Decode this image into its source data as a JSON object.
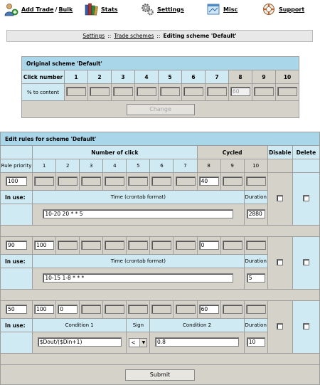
{
  "nav": {
    "add_trade_label": "Add Trade",
    "separator": "/",
    "bulk_label": "Bulk",
    "stats_label": "Stats",
    "settings_label": "Settings",
    "misc_label": "Misc",
    "support_label": "Support"
  },
  "breadcrumb": {
    "settings": "Settings",
    "sep1": "::",
    "trade_schemes": "Trade schemes",
    "sep2": "::",
    "current": "Editing scheme 'Default'"
  },
  "original_scheme": {
    "title": "Original scheme 'Default'",
    "click_number_label": "Click number",
    "columns": [
      "1",
      "2",
      "3",
      "4",
      "5",
      "6",
      "7",
      "8",
      "9",
      "10"
    ],
    "row_label": "% to content",
    "values": [
      "",
      "",
      "",
      "",
      "",
      "",
      "",
      "60",
      "",
      ""
    ],
    "change_button": "Change"
  },
  "rules": {
    "title": "Edit rules for scheme 'Default'",
    "number_of_click": "Number of click",
    "cycled": "Cycled",
    "disable": "Disable",
    "delete": "Delete",
    "rule_priority": "Rule priority",
    "columns": [
      "1",
      "2",
      "3",
      "4",
      "5",
      "6",
      "7",
      "8",
      "9",
      "10"
    ],
    "in_use": "In use:",
    "time_label": "Time (crontab format)",
    "duration_label": "Duration",
    "condition1_label": "Condition 1",
    "sign_label": "Sign",
    "condition2_label": "Condition 2",
    "rule1": {
      "priority": "100",
      "values": [
        "",
        "",
        "",
        "",
        "",
        "",
        "",
        "40",
        "",
        ""
      ],
      "time": "10-20 20 * * 5",
      "duration": "2880"
    },
    "rule2": {
      "priority": "90",
      "values": [
        "100",
        "",
        "",
        "",
        "",
        "",
        "",
        "0",
        "",
        ""
      ],
      "time": "10-15 1-8 * * *",
      "duration": "5"
    },
    "rule3": {
      "priority": "50",
      "values": [
        "100",
        "0",
        "",
        "",
        "",
        "",
        "",
        "60",
        "",
        ""
      ],
      "condition1": "$Dout/($Din+1)",
      "sign": "<",
      "condition2": "0.8",
      "duration": "10"
    },
    "submit_button": "Submit"
  }
}
